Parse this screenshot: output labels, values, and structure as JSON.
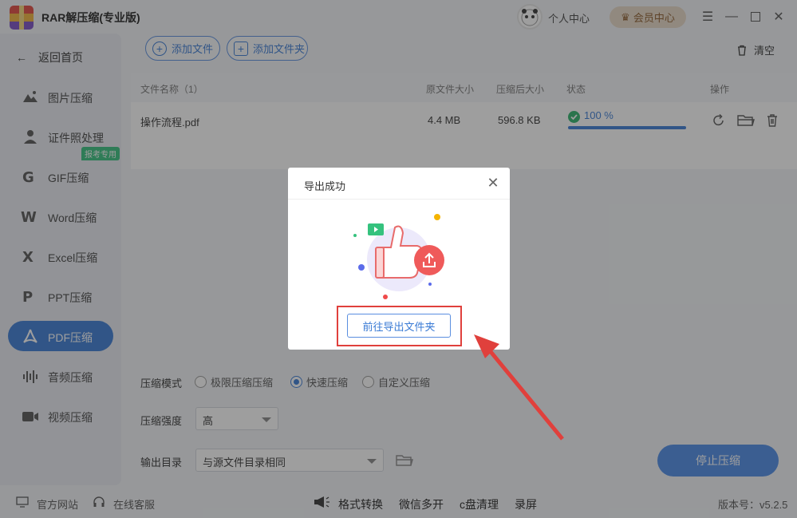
{
  "titlebar": {
    "app_title": "RAR解压缩(专业版)",
    "personal": "个人中心",
    "vip": "会员中心"
  },
  "sidebar": {
    "back": "返回首页",
    "badge": "报考专用",
    "items": [
      {
        "label": "图片压缩"
      },
      {
        "label": "证件照处理"
      },
      {
        "label": "GIF压缩"
      },
      {
        "label": "Word压缩"
      },
      {
        "label": "Excel压缩"
      },
      {
        "label": "PPT压缩"
      },
      {
        "label": "PDF压缩"
      },
      {
        "label": "音频压缩"
      },
      {
        "label": "视频压缩"
      }
    ]
  },
  "toolbar": {
    "add_file": "添加文件",
    "add_folder": "添加文件夹",
    "clear": "清空"
  },
  "table": {
    "headers": {
      "name": "文件名称（1）",
      "orig": "原文件大小",
      "comp": "压缩后大小",
      "status": "状态",
      "ops": "操作"
    },
    "rows": [
      {
        "name": "操作流程.pdf",
        "orig": "4.4 MB",
        "comp": "596.8 KB",
        "status": "100 %",
        "progress": 1.0
      }
    ]
  },
  "settings": {
    "mode_label": "压缩模式",
    "modes": [
      "极限压缩压缩",
      "快速压缩",
      "自定义压缩"
    ],
    "selected_mode": "快速压缩",
    "strength_label": "压缩强度",
    "strength_value": "高",
    "output_label": "输出目录",
    "output_value": "与源文件目录相同",
    "stop_button": "停止压缩"
  },
  "footer": {
    "website": "官方网站",
    "service": "在线客服",
    "format": "格式转换",
    "wechat": "微信多开",
    "cclean": "c盘清理",
    "record": "录屏",
    "version": "版本号：v5.2.5"
  },
  "dialog": {
    "title": "导出成功",
    "button": "前往导出文件夹"
  },
  "colors": {
    "accent": "#3a7bd5",
    "success": "#2db36b",
    "highlight": "#e0403c"
  }
}
